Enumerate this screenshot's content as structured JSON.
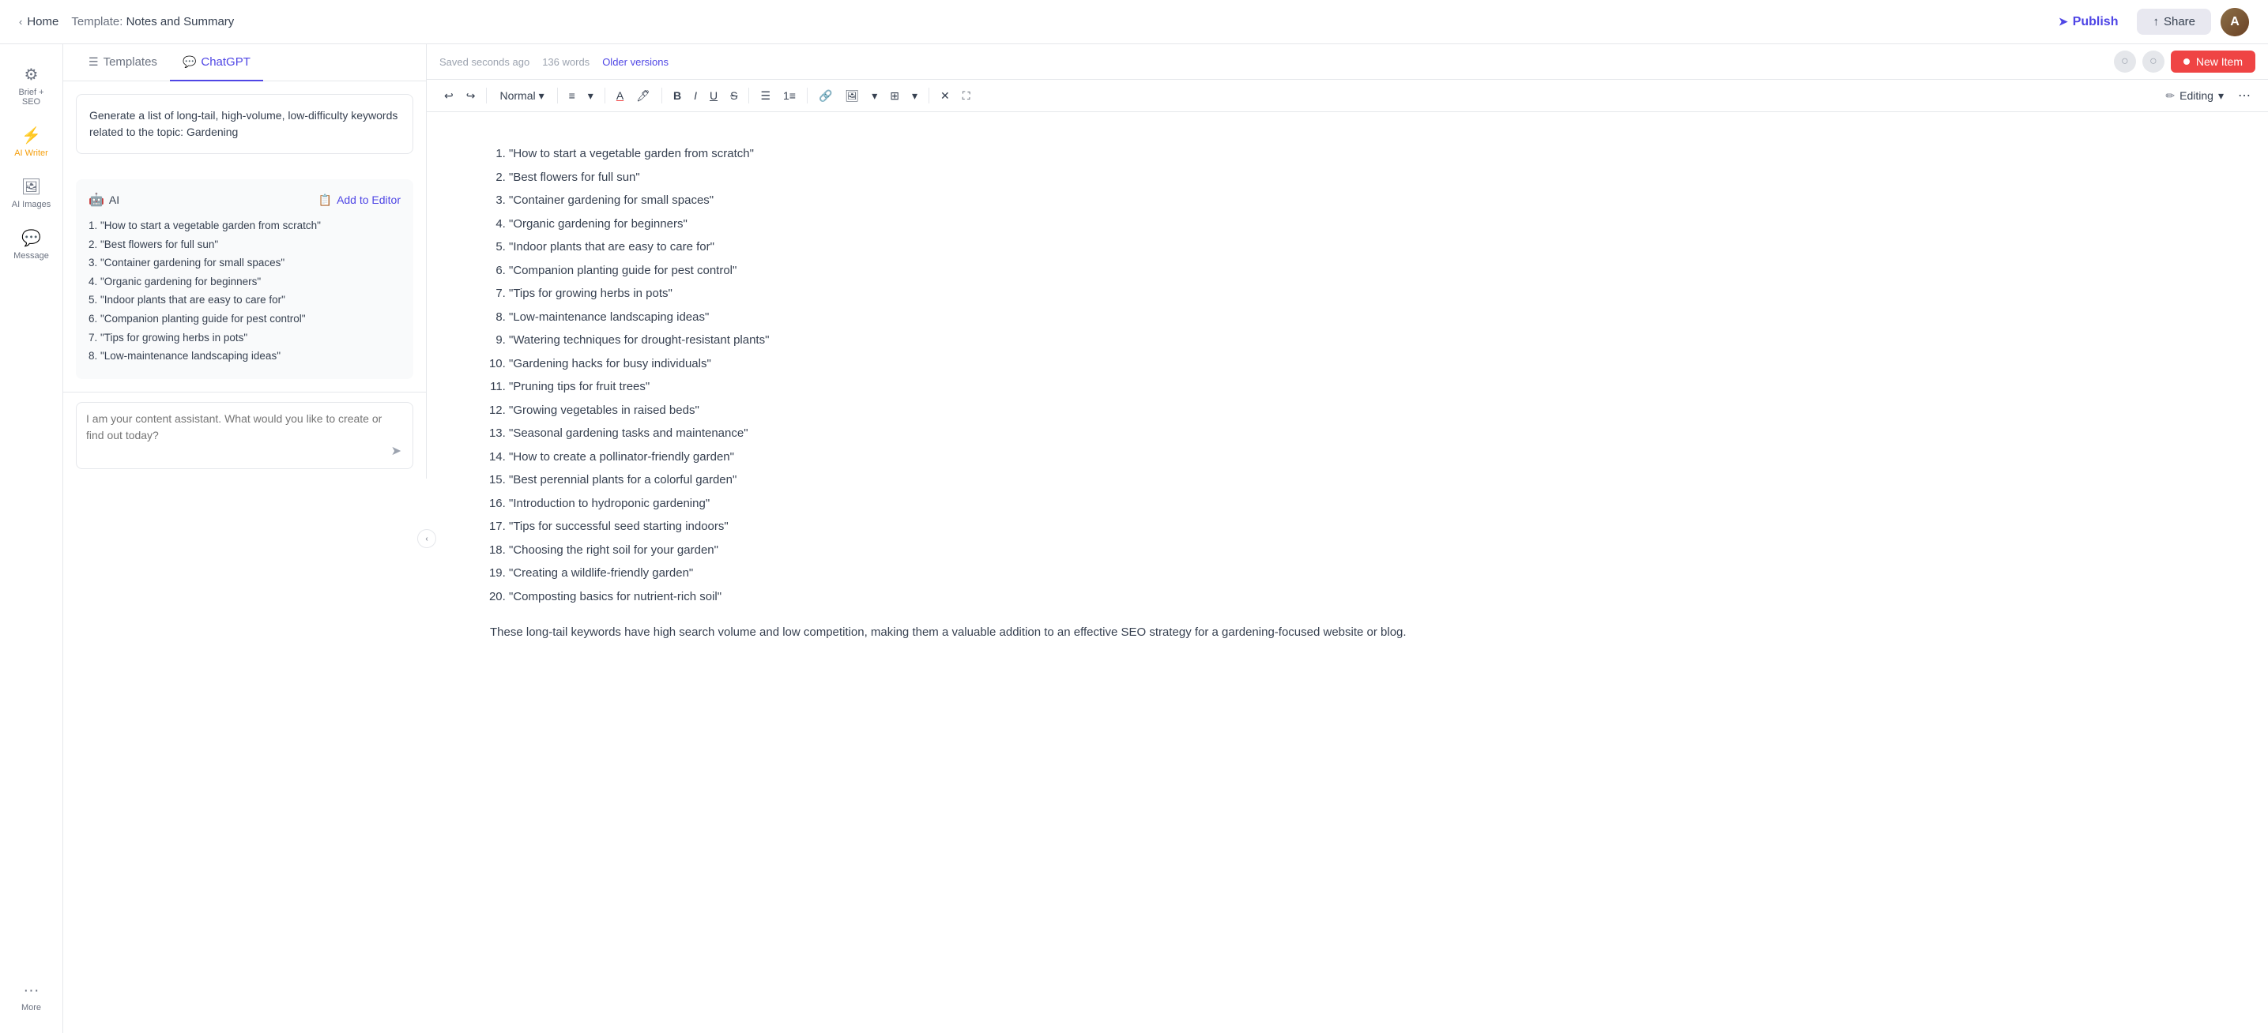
{
  "topbar": {
    "home_label": "Home",
    "breadcrumb_prefix": "Template:",
    "breadcrumb_title": "Notes and Summary",
    "publish_label": "Publish",
    "share_label": "Share",
    "avatar_initials": "A"
  },
  "sidebar": {
    "items": [
      {
        "id": "brief-seo",
        "icon": "⚙",
        "label": "Brief + SEO",
        "active": false
      },
      {
        "id": "ai-writer",
        "icon": "⚡",
        "label": "AI Writer",
        "active": true
      },
      {
        "id": "ai-images",
        "icon": "🖼",
        "label": "AI Images",
        "active": false
      },
      {
        "id": "message",
        "icon": "💬",
        "label": "Message",
        "active": false
      },
      {
        "id": "more",
        "icon": "···",
        "label": "More",
        "active": false
      }
    ]
  },
  "panel": {
    "tabs": [
      {
        "id": "templates",
        "icon": "☰",
        "label": "Templates",
        "active": false
      },
      {
        "id": "chatgpt",
        "icon": "💬",
        "label": "ChatGPT",
        "active": true
      }
    ],
    "template_hint": "Generate a list of long-tail, high-volume, low-difficulty keywords related to the topic: Gardening",
    "ai_label": "AI",
    "add_to_editor_label": "Add to Editor",
    "ai_content_lines": [
      "1. \"How to start a vegetable garden from scratch\"",
      "2. \"Best flowers for full sun\"",
      "3. \"Container gardening for small spaces\"",
      "4. \"Organic gardening for beginners\"",
      "5. \"Indoor plants that are easy to care for\"",
      "6. \"Companion planting guide for pest control\"",
      "7. \"Tips for growing herbs in pots\"",
      "8. \"Low-maintenance landscaping ideas\""
    ],
    "chat_placeholder": "I am your content assistant. What would you like to create or find out today?"
  },
  "editor": {
    "saved_status": "Saved seconds ago",
    "word_count": "136 words",
    "older_versions_label": "Older versions",
    "new_item_label": "New Item",
    "style_label": "Normal",
    "editing_label": "Editing",
    "content_items": [
      "\"How to start a vegetable garden from scratch\"",
      "\"Best flowers for full sun\"",
      "\"Container gardening for small spaces\"",
      "\"Organic gardening for beginners\"",
      "\"Indoor plants that are easy to care for\"",
      "\"Companion planting guide for pest control\"",
      "\"Tips for growing herbs in pots\"",
      "\"Low-maintenance landscaping ideas\"",
      "\"Watering techniques for drought-resistant plants\"",
      "\"Gardening hacks for busy individuals\"",
      "\"Pruning tips for fruit trees\"",
      "\"Growing vegetables in raised beds\"",
      "\"Seasonal gardening tasks and maintenance\"",
      "\"How to create a pollinator-friendly garden\"",
      "\"Best perennial plants for a colorful garden\"",
      "\"Introduction to hydroponic gardening\"",
      "\"Tips for successful seed starting indoors\"",
      "\"Choosing the right soil for your garden\"",
      "\"Creating a wildlife-friendly garden\"",
      "\"Composting basics for nutrient-rich soil\""
    ],
    "footer_text": "These long-tail keywords have high search volume and low competition, making them a valuable addition to an effective SEO strategy for a gardening-focused website or blog."
  }
}
